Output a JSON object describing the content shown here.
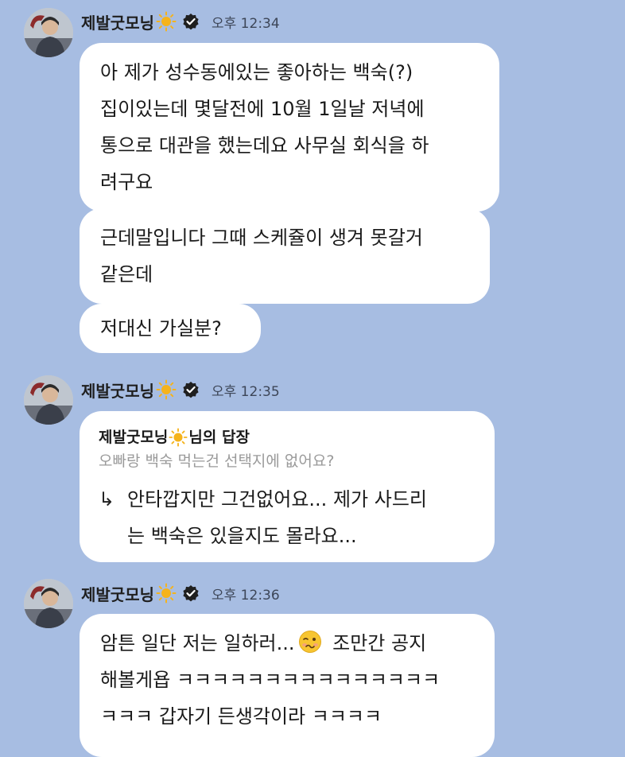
{
  "sender": {
    "name": "제발굿모닝",
    "avatar_icon": "profile-photo",
    "badge_icons": [
      "sun-icon",
      "verified-icon"
    ]
  },
  "colors": {
    "background": "#a7bde2",
    "bubble": "#ffffff",
    "verified_badge": "#1f1f1f",
    "sun": "#f5b31c"
  },
  "messages": [
    {
      "time": "오후 12:34",
      "bubbles": [
        {
          "lines": [
            "아 제가 성수동에있는 좋아하는 백숙(?)",
            "집이있는데 몇달전에 10월 1일날 저녁에",
            "통으로 대관을 했는데요 사무실 회식을 하",
            "려구요"
          ]
        },
        {
          "lines": [
            "근데말입니다 그때 스케쥴이 생겨 못갈거",
            "같은데"
          ]
        },
        {
          "lines": [
            "저대신 가실분?"
          ]
        }
      ]
    },
    {
      "time": "오후 12:35",
      "reply": {
        "to_name": "제발굿모닝",
        "suffix": "님의 답장",
        "quoted": "오빠랑 백숙 먹는건 선택지에 없어요?",
        "arrow": "↳",
        "lines": [
          "안타깝지만 그건없어요... 제가 사드리",
          "는 백숙은 있을지도 몰라요..."
        ]
      }
    },
    {
      "time": "오후 12:36",
      "bubbles": [
        {
          "line1_before": "암튼 일단 저는 일하러...",
          "emoji_icon": "woozy-face-icon",
          "line1_after": " 조만간 공지",
          "lines": [
            "해볼게욥 ㅋㅋㅋㅋㅋㅋㅋㅋㅋㅋㅋㅋㅋㅋㅋ",
            "ㅋㅋㅋ 갑자기 든생각이라 ㅋㅋㅋㅋ"
          ]
        }
      ]
    }
  ]
}
